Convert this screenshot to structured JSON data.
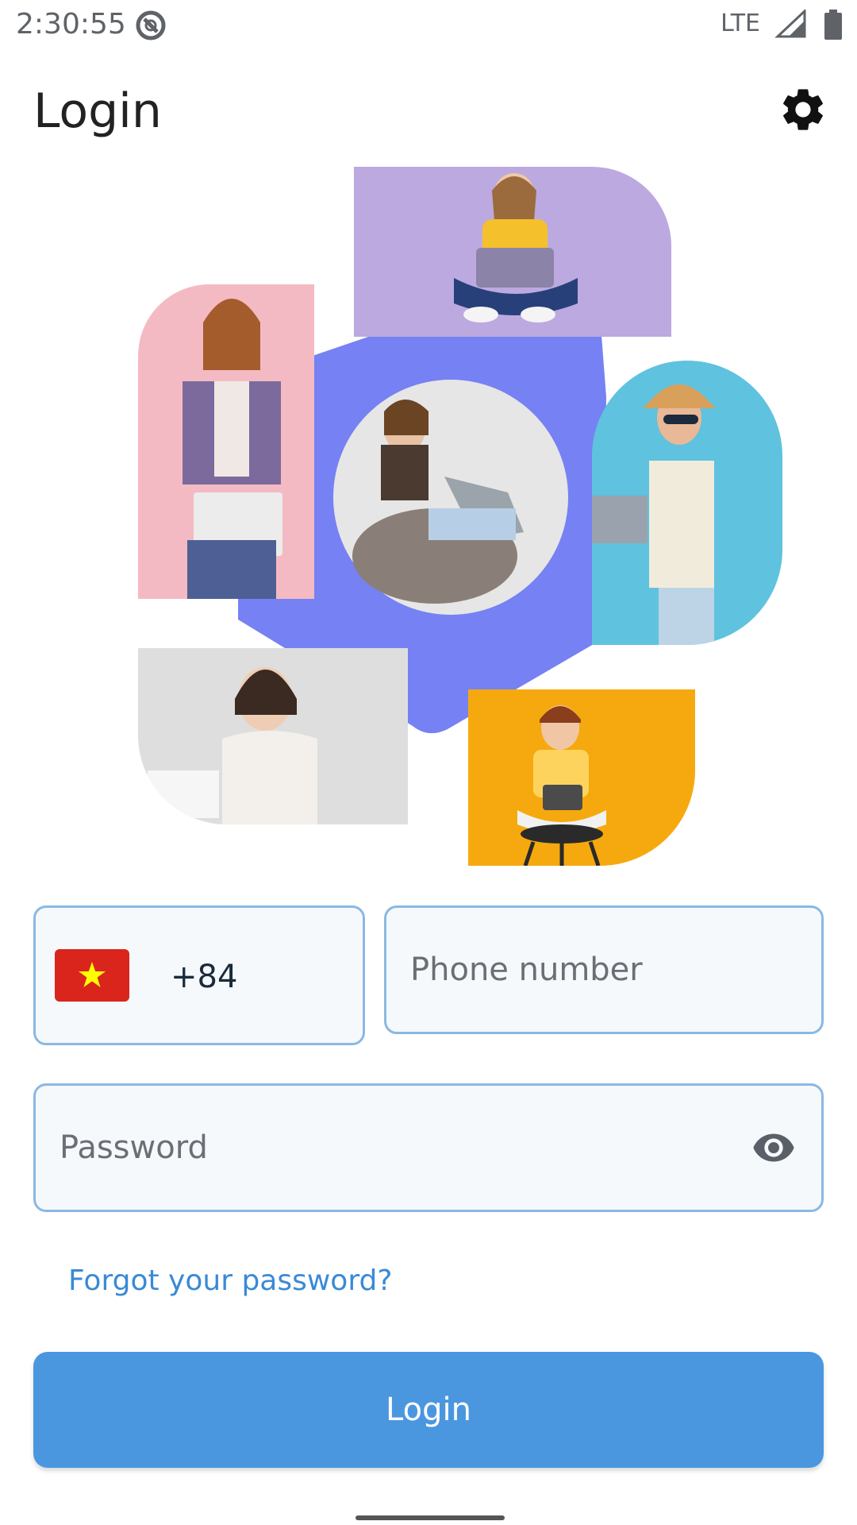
{
  "status_bar": {
    "time": "2:30:55",
    "network": "LTE"
  },
  "app_bar": {
    "title": "Login",
    "settings_icon": "gear-icon"
  },
  "form": {
    "country": {
      "flag": "vietnam-flag-icon",
      "dial_code": "+84"
    },
    "phone": {
      "placeholder": "Phone number",
      "value": ""
    },
    "password": {
      "placeholder": "Password",
      "value": "",
      "toggle_icon": "eye-icon"
    },
    "forgot_label": "Forgot your password?",
    "login_label": "Login"
  },
  "colors": {
    "primary": "#4a97e0",
    "link": "#3a8ad6",
    "field_border": "#8bb8e3",
    "field_bg": "#f5f9fc",
    "hexagon": "#7681f3"
  }
}
